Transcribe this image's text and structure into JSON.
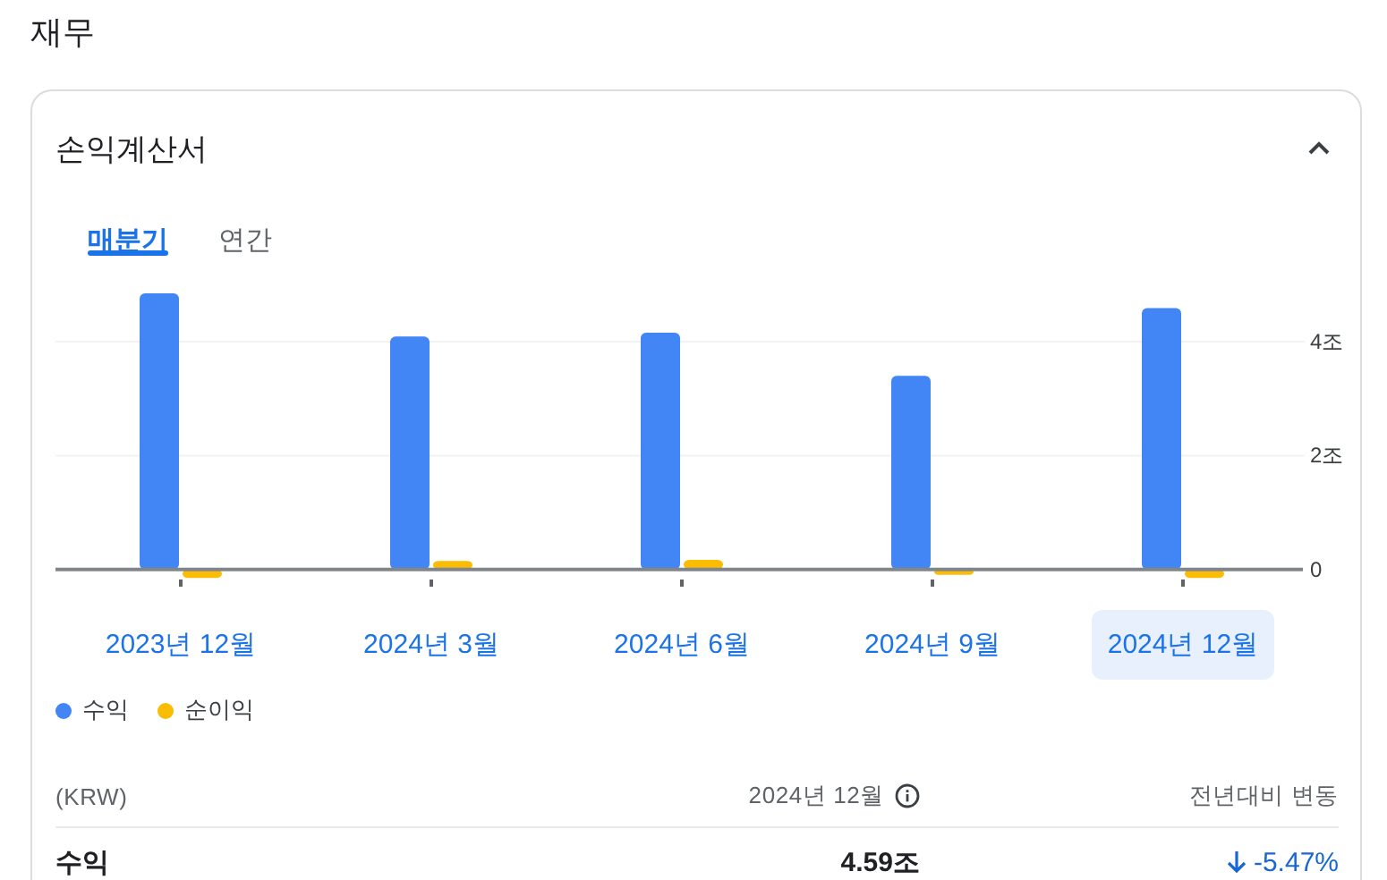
{
  "title": "재무",
  "section": {
    "title": "손익계산서",
    "expanded": true,
    "tabs": [
      {
        "label": "매분기",
        "selected": true
      },
      {
        "label": "연간",
        "selected": false
      }
    ],
    "chart_data": {
      "type": "bar",
      "ylim": [
        -0.2,
        4.9
      ],
      "yticks": [
        {
          "value": 0,
          "label": "0"
        },
        {
          "value": 2,
          "label": "2조"
        },
        {
          "value": 4,
          "label": "4조"
        }
      ],
      "series": [
        {
          "name": "수익",
          "color": "#4285f4",
          "values": [
            4.85,
            4.09,
            4.16,
            3.4,
            4.59
          ]
        },
        {
          "name": "순이익",
          "color": "#fbbc04",
          "values": [
            -0.15,
            0.15,
            0.17,
            -0.05,
            -0.15
          ]
        }
      ]
    },
    "periods": [
      {
        "label": "2023년 12월",
        "selected": false
      },
      {
        "label": "2024년 3월",
        "selected": false
      },
      {
        "label": "2024년 6월",
        "selected": false
      },
      {
        "label": "2024년 9월",
        "selected": false
      },
      {
        "label": "2024년 12월",
        "selected": true
      }
    ],
    "table": {
      "columns": [
        "(KRW)",
        "2024년 12월",
        "전년대비 변동"
      ],
      "rows": [
        {
          "label": "수익",
          "value": "4.59조",
          "change": "-5.47%",
          "down": true
        }
      ]
    }
  }
}
